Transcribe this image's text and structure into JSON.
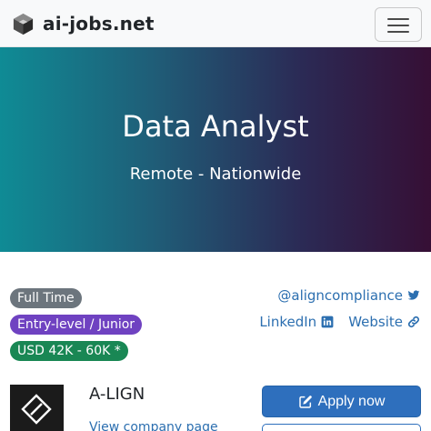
{
  "navbar": {
    "brand": "ai-jobs.net",
    "logo_icon": "cube-logo-icon",
    "menu_icon": "hamburger-menu-icon"
  },
  "hero": {
    "title": "Data Analyst",
    "location": "Remote - Nationwide",
    "gradient_colors": [
      "#0f8b95",
      "#360f35"
    ]
  },
  "badges": {
    "employment": "Full Time",
    "level": "Entry-level / Junior",
    "salary": "USD 42K - 60K *"
  },
  "social": {
    "twitter_handle": "@aligncompliance",
    "twitter_icon": "twitter-icon",
    "linkedin_label": "LinkedIn",
    "linkedin_icon": "linkedin-icon",
    "website_label": "Website",
    "website_icon": "link-icon"
  },
  "company": {
    "name": "A-LIGN",
    "view_page_label": "View company page",
    "logo_icon": "a-lign-logo-icon"
  },
  "actions": {
    "apply_label": "Apply now",
    "apply_icon": "edit-icon"
  },
  "colors": {
    "accent": "#2e6fbd",
    "badge_gray": "#6c757d",
    "badge_purple": "#6f42c1",
    "badge_green": "#198754"
  }
}
